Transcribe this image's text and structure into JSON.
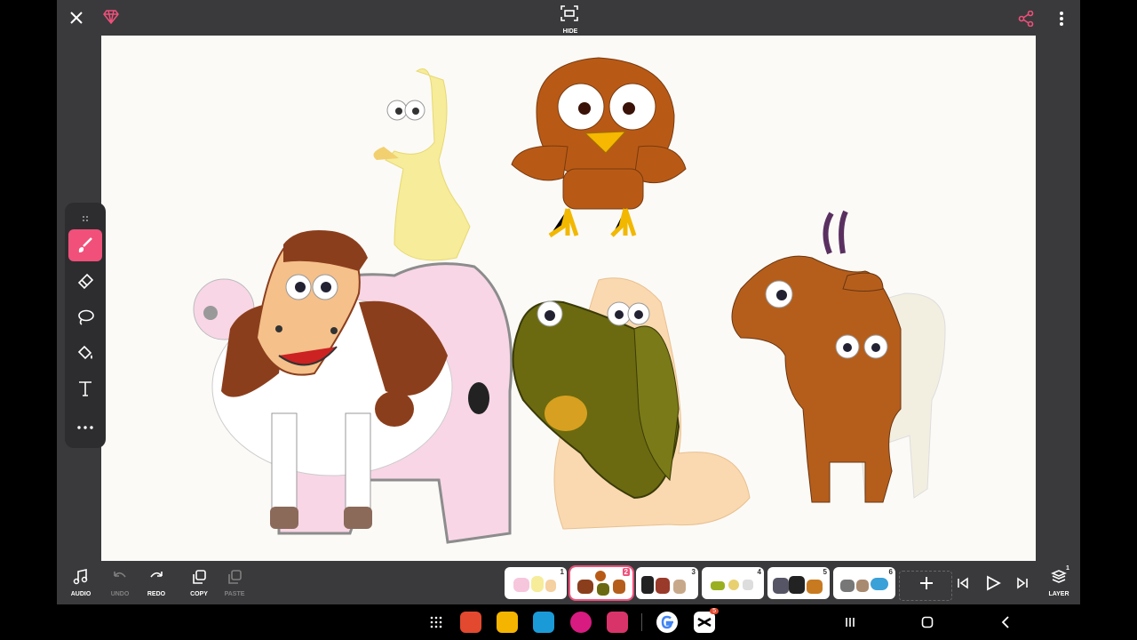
{
  "top": {
    "hide_label": "HIDE"
  },
  "colors": {
    "accent": "#f0507a",
    "canvas": "#fbfaf7",
    "panel": "#3a3a3c"
  },
  "icons": {
    "close": "close-icon",
    "premium": "diamond-icon",
    "hide": "hide-icon",
    "share": "share-icon",
    "more": "more-vertical-icon"
  },
  "tools": [
    "brush-icon",
    "eraser-icon",
    "lasso-icon",
    "fill-icon",
    "text-icon",
    "more-horizontal-icon"
  ],
  "bottom": {
    "audio": "AUDIO",
    "undo": "UNDO",
    "redo": "REDO",
    "copy": "COPY",
    "paste": "PASTE",
    "layer": "LAYER",
    "layer_count": "1"
  },
  "scenes": [
    {
      "num": "1",
      "active": false
    },
    {
      "num": "2",
      "active": true
    },
    {
      "num": "3",
      "active": false
    },
    {
      "num": "4",
      "active": false
    },
    {
      "num": "5",
      "active": false
    },
    {
      "num": "6",
      "active": false
    }
  ],
  "navbar": {
    "capcut_badge": "5"
  }
}
